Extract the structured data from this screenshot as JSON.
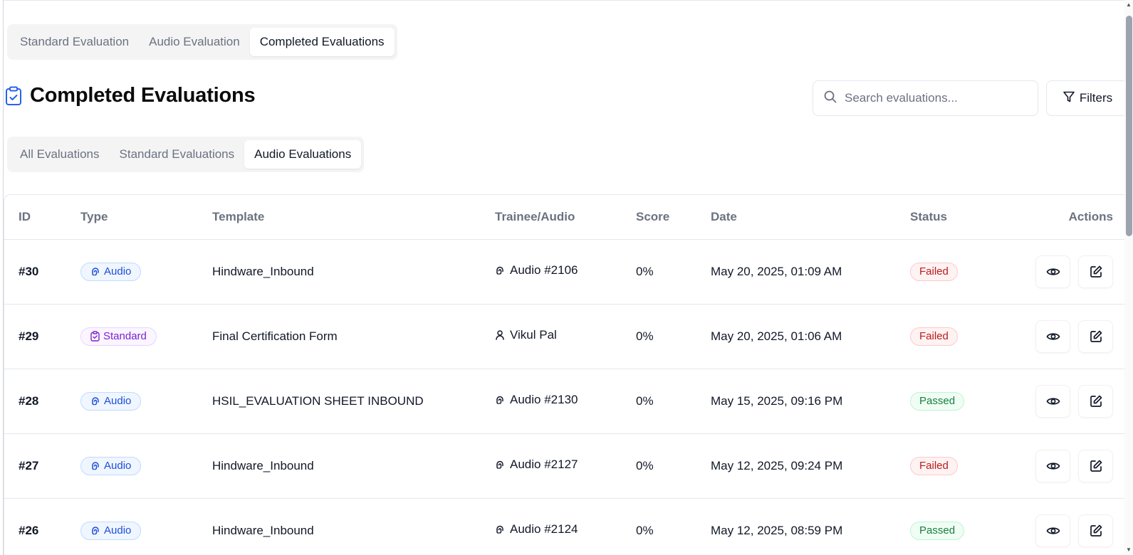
{
  "top_tabs": {
    "items": [
      {
        "label": "Standard Evaluation"
      },
      {
        "label": "Audio Evaluation"
      },
      {
        "label": "Completed Evaluations"
      }
    ],
    "active": "Completed Evaluations"
  },
  "page": {
    "title": "Completed Evaluations",
    "title_icon": "clipboard-check-icon"
  },
  "search": {
    "placeholder": "Search evaluations...",
    "value": ""
  },
  "filters": {
    "label": "Filters"
  },
  "sub_tabs": {
    "items": [
      {
        "label": "All Evaluations"
      },
      {
        "label": "Standard Evaluations"
      },
      {
        "label": "Audio Evaluations"
      }
    ],
    "active": "Audio Evaluations"
  },
  "table": {
    "headers": {
      "id": "ID",
      "type": "Type",
      "template": "Template",
      "trainee": "Trainee/Audio",
      "score": "Score",
      "date": "Date",
      "status": "Status",
      "actions": "Actions"
    },
    "rows": [
      {
        "id": "#30",
        "type": "Audio",
        "template": "Hindware_Inbound",
        "trainee": "Audio #2106",
        "score": "0%",
        "date": "May 20, 2025, 01:09 AM",
        "status": "Failed"
      },
      {
        "id": "#29",
        "type": "Standard",
        "template": "Final Certification Form",
        "trainee": "Vikul Pal",
        "score": "0%",
        "date": "May 20, 2025, 01:06 AM",
        "status": "Failed"
      },
      {
        "id": "#28",
        "type": "Audio",
        "template": "HSIL_EVALUATION SHEET INBOUND",
        "trainee": "Audio #2130",
        "score": "0%",
        "date": "May 15, 2025, 09:16 PM",
        "status": "Passed"
      },
      {
        "id": "#27",
        "type": "Audio",
        "template": "Hindware_Inbound",
        "trainee": "Audio #2127",
        "score": "0%",
        "date": "May 12, 2025, 09:24 PM",
        "status": "Failed"
      },
      {
        "id": "#26",
        "type": "Audio",
        "template": "Hindware_Inbound",
        "trainee": "Audio #2124",
        "score": "0%",
        "date": "May 12, 2025, 08:59 PM",
        "status": "Passed"
      }
    ]
  },
  "colors": {
    "audio_badge": "#1d4ed8",
    "standard_badge": "#7e22ce",
    "failed": "#b91c1c",
    "passed": "#15803d",
    "accent_icon": "#2563eb"
  }
}
